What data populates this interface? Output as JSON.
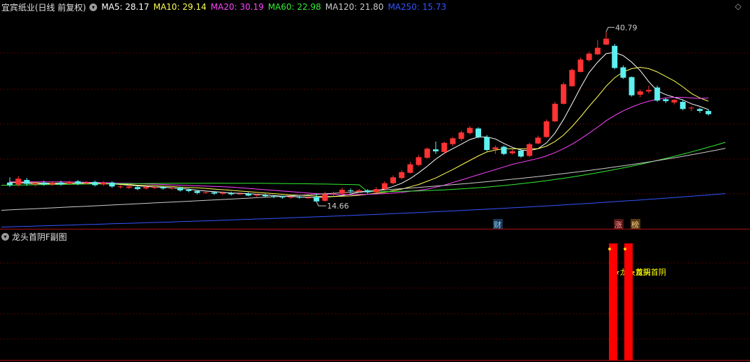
{
  "header": {
    "title": "宜宾纸业(日线 前复权)",
    "ma_labels": [
      {
        "text": "MA5: 28.17",
        "color": "#ffffff"
      },
      {
        "text": "MA10: 29.14",
        "color": "#ffff55"
      },
      {
        "text": "MA20: 30.19",
        "color": "#ff44ff"
      },
      {
        "text": "MA60: 22.98",
        "color": "#33ee33"
      },
      {
        "text": "MA120: 21.80",
        "color": "#cccccc"
      },
      {
        "text": "MA250: 15.73",
        "color": "#3355ff"
      }
    ],
    "collapse_icon": "diamond-icon"
  },
  "main_chart": {
    "high_label": "40.79",
    "low_label": "14.66",
    "markers": [
      {
        "text": "财",
        "bg": "#1a3555",
        "color": "#8fd8ff"
      },
      {
        "text": "涨",
        "bg": "#551515",
        "color": "#ff9a9a"
      },
      {
        "text": "榜",
        "bg": "#553a15",
        "color": "#ffcc88"
      }
    ],
    "colors": {
      "up": "#ff3333",
      "down": "#5ff0f0",
      "grid": "#5a0000"
    }
  },
  "sub_chart": {
    "title": "龙头首阴F副图",
    "signal_labels": [
      "★龙头首阴",
      "★龙头首阴"
    ],
    "bar_color": "#ff0000",
    "label_color": "#ffff00"
  },
  "chart_data": {
    "type": "candlestick",
    "price_range": [
      10.5,
      43.5
    ],
    "candles": [
      [
        17.6,
        17.2,
        18.4,
        16.9
      ],
      [
        17.3,
        18.2,
        18.6,
        17.0
      ],
      [
        18.0,
        17.4,
        18.3,
        17.1
      ],
      [
        17.3,
        17.5,
        17.7,
        17.0
      ],
      [
        17.6,
        17.3,
        17.9,
        17.1
      ],
      [
        17.3,
        17.5,
        17.8,
        17.1
      ],
      [
        17.6,
        17.3,
        17.9,
        17.1
      ],
      [
        17.4,
        17.7,
        17.9,
        17.2
      ],
      [
        17.8,
        17.4,
        18.0,
        17.2
      ],
      [
        17.5,
        17.6,
        17.8,
        17.3
      ],
      [
        17.7,
        17.2,
        17.9,
        17.0
      ],
      [
        17.3,
        17.6,
        17.8,
        17.1
      ],
      [
        17.6,
        17.0,
        17.8,
        16.8
      ],
      [
        16.9,
        17.0,
        17.2,
        16.7
      ],
      [
        16.8,
        17.0,
        17.3,
        16.6
      ],
      [
        16.9,
        16.6,
        17.1,
        16.4
      ],
      [
        16.7,
        16.9,
        17.1,
        16.5
      ],
      [
        16.8,
        16.9,
        17.0,
        16.6
      ],
      [
        16.9,
        16.7,
        17.1,
        16.5
      ],
      [
        16.7,
        16.8,
        17.0,
        16.5
      ],
      [
        16.8,
        16.4,
        17.0,
        16.2
      ],
      [
        16.5,
        16.3,
        16.7,
        16.1
      ],
      [
        16.3,
        16.0,
        16.5,
        15.8
      ],
      [
        16.0,
        16.1,
        16.3,
        15.9
      ],
      [
        16.1,
        15.9,
        16.3,
        15.7
      ],
      [
        15.9,
        16.0,
        16.2,
        15.7
      ],
      [
        16.0,
        15.8,
        16.2,
        15.6
      ],
      [
        15.8,
        15.9,
        16.1,
        15.7
      ],
      [
        15.9,
        15.6,
        16.1,
        15.5
      ],
      [
        15.6,
        15.7,
        15.9,
        15.4
      ],
      [
        15.7,
        15.5,
        15.9,
        15.3
      ],
      [
        15.5,
        15.4,
        15.7,
        15.2
      ],
      [
        15.4,
        15.3,
        15.6,
        15.1
      ],
      [
        15.3,
        15.4,
        15.5,
        15.1
      ],
      [
        15.4,
        15.3,
        15.6,
        15.1
      ],
      [
        15.3,
        15.3,
        15.5,
        15.1
      ],
      [
        15.4,
        14.7,
        15.9,
        14.66
      ],
      [
        14.8,
        15.8,
        16.2,
        14.66
      ],
      [
        15.8,
        15.9,
        16.2,
        15.5
      ],
      [
        15.9,
        16.5,
        16.8,
        15.7
      ],
      [
        16.4,
        16.3,
        16.7,
        16.0
      ],
      [
        16.2,
        16.4,
        16.6,
        16.0
      ],
      [
        16.4,
        16.1,
        16.6,
        15.9
      ],
      [
        16.1,
        16.6,
        16.9,
        16.0
      ],
      [
        16.6,
        17.5,
        17.8,
        16.5
      ],
      [
        17.5,
        18.4,
        18.7,
        17.3
      ],
      [
        18.3,
        19.2,
        19.5,
        18.1
      ],
      [
        19.1,
        20.4,
        20.8,
        19.0
      ],
      [
        20.3,
        21.5,
        21.8,
        20.1
      ],
      [
        21.4,
        22.8,
        23.0,
        21.3
      ],
      [
        22.7,
        22.4,
        23.9,
        22.0
      ],
      [
        22.3,
        23.7,
        23.9,
        22.0
      ],
      [
        23.5,
        24.4,
        24.6,
        23.2
      ],
      [
        24.3,
        25.3,
        25.6,
        24.0
      ],
      [
        25.2,
        26.0,
        26.3,
        25.0
      ],
      [
        25.9,
        24.6,
        26.1,
        24.4
      ],
      [
        24.6,
        22.6,
        24.9,
        22.4
      ],
      [
        22.7,
        23.0,
        23.3,
        22.0
      ],
      [
        23.1,
        22.0,
        23.3,
        21.8
      ],
      [
        22.1,
        22.4,
        22.7,
        21.9
      ],
      [
        22.5,
        21.6,
        22.8,
        21.4
      ],
      [
        21.7,
        23.5,
        23.7,
        21.5
      ],
      [
        23.6,
        24.5,
        24.8,
        23.5
      ],
      [
        24.6,
        27.0,
        27.3,
        24.5
      ],
      [
        27.0,
        29.7,
        30.0,
        26.9
      ],
      [
        29.7,
        32.7,
        33.0,
        29.6
      ],
      [
        32.4,
        34.9,
        35.1,
        32.3
      ],
      [
        34.6,
        36.5,
        36.8,
        34.5
      ],
      [
        36.4,
        37.4,
        37.7,
        36.2
      ],
      [
        37.3,
        38.3,
        39.5,
        37.2
      ],
      [
        38.8,
        39.7,
        40.79,
        38.7
      ],
      [
        38.6,
        35.2,
        38.9,
        35.0
      ],
      [
        35.3,
        33.7,
        35.6,
        33.5
      ],
      [
        33.8,
        31.0,
        33.9,
        30.8
      ],
      [
        31.1,
        31.6,
        31.9,
        30.7
      ],
      [
        31.6,
        31.8,
        32.5,
        31.3
      ],
      [
        32.2,
        30.2,
        32.5,
        30.0
      ],
      [
        30.4,
        30.1,
        30.6,
        29.8
      ],
      [
        29.9,
        30.3,
        30.4,
        29.6
      ],
      [
        30.0,
        28.9,
        30.3,
        28.7
      ],
      [
        29.0,
        29.1,
        29.3,
        28.6
      ],
      [
        28.9,
        28.6,
        29.1,
        28.3
      ],
      [
        28.6,
        28.1,
        28.9,
        27.9
      ]
    ],
    "moving_averages": {
      "MA5": [
        17.7,
        17.6,
        17.5,
        17.4,
        17.4,
        17.4,
        17.4,
        17.5,
        17.5,
        17.6,
        17.5,
        17.5,
        17.4,
        17.3,
        17.2,
        17.1,
        17.0,
        16.9,
        16.9,
        16.8,
        16.7,
        16.6,
        16.4,
        16.3,
        16.2,
        16.1,
        16.0,
        15.95,
        15.9,
        15.8,
        15.7,
        15.6,
        15.5,
        15.45,
        15.4,
        15.35,
        15.3,
        15.35,
        15.45,
        15.6,
        15.85,
        16.1,
        16.25,
        16.35,
        16.6,
        17.0,
        17.5,
        18.2,
        19.1,
        20.1,
        21.2,
        22.1,
        22.8,
        23.5,
        24.2,
        24.6,
        24.6,
        24.3,
        23.6,
        23.0,
        22.6,
        22.5,
        22.8,
        23.7,
        25.2,
        27.3,
        29.7,
        32.2,
        34.5,
        36.1,
        37.4,
        37.6,
        37.1,
        36.1,
        34.8,
        33.1,
        31.7,
        31.1,
        30.7,
        30.3,
        29.7,
        29.3,
        28.8
      ],
      "MA10": [
        17.6,
        17.6,
        17.6,
        17.6,
        17.5,
        17.5,
        17.5,
        17.5,
        17.5,
        17.5,
        17.5,
        17.4,
        17.4,
        17.35,
        17.3,
        17.2,
        17.15,
        17.1,
        17.05,
        17.0,
        16.9,
        16.85,
        16.8,
        16.7,
        16.6,
        16.5,
        16.4,
        16.3,
        16.2,
        16.1,
        16.0,
        15.9,
        15.8,
        15.7,
        15.65,
        15.6,
        15.5,
        15.45,
        15.45,
        15.5,
        15.55,
        15.65,
        15.8,
        15.95,
        16.1,
        16.35,
        16.6,
        16.95,
        17.3,
        17.8,
        18.3,
        18.95,
        19.6,
        20.3,
        21.0,
        21.7,
        22.3,
        22.6,
        22.8,
        22.8,
        22.8,
        22.8,
        22.8,
        23.2,
        23.9,
        24.9,
        26.2,
        27.7,
        29.3,
        30.8,
        32.4,
        33.7,
        34.6,
        35.1,
        35.3,
        35.1,
        34.6,
        33.9,
        33.2,
        32.3,
        31.3,
        30.6,
        30.1
      ],
      "MA20": [
        17.7,
        17.7,
        17.7,
        17.7,
        17.7,
        17.7,
        17.7,
        17.7,
        17.65,
        17.65,
        17.6,
        17.6,
        17.55,
        17.5,
        17.5,
        17.45,
        17.4,
        17.35,
        17.3,
        17.25,
        17.2,
        17.15,
        17.1,
        17.05,
        17.0,
        16.95,
        16.9,
        16.8,
        16.7,
        16.6,
        16.5,
        16.4,
        16.3,
        16.2,
        16.1,
        16.0,
        15.9,
        15.85,
        15.8,
        15.75,
        15.75,
        15.75,
        15.8,
        15.85,
        15.9,
        16.0,
        16.1,
        16.25,
        16.4,
        16.6,
        16.9,
        17.2,
        17.6,
        18.0,
        18.4,
        18.8,
        19.2,
        19.6,
        20.0,
        20.4,
        20.7,
        21.0,
        21.3,
        21.7,
        22.2,
        22.8,
        23.5,
        24.3,
        25.2,
        26.1,
        27.1,
        27.9,
        28.6,
        29.2,
        29.7,
        30.1,
        30.4,
        30.6,
        30.7,
        30.7,
        30.6,
        30.5,
        30.6
      ]
    }
  }
}
